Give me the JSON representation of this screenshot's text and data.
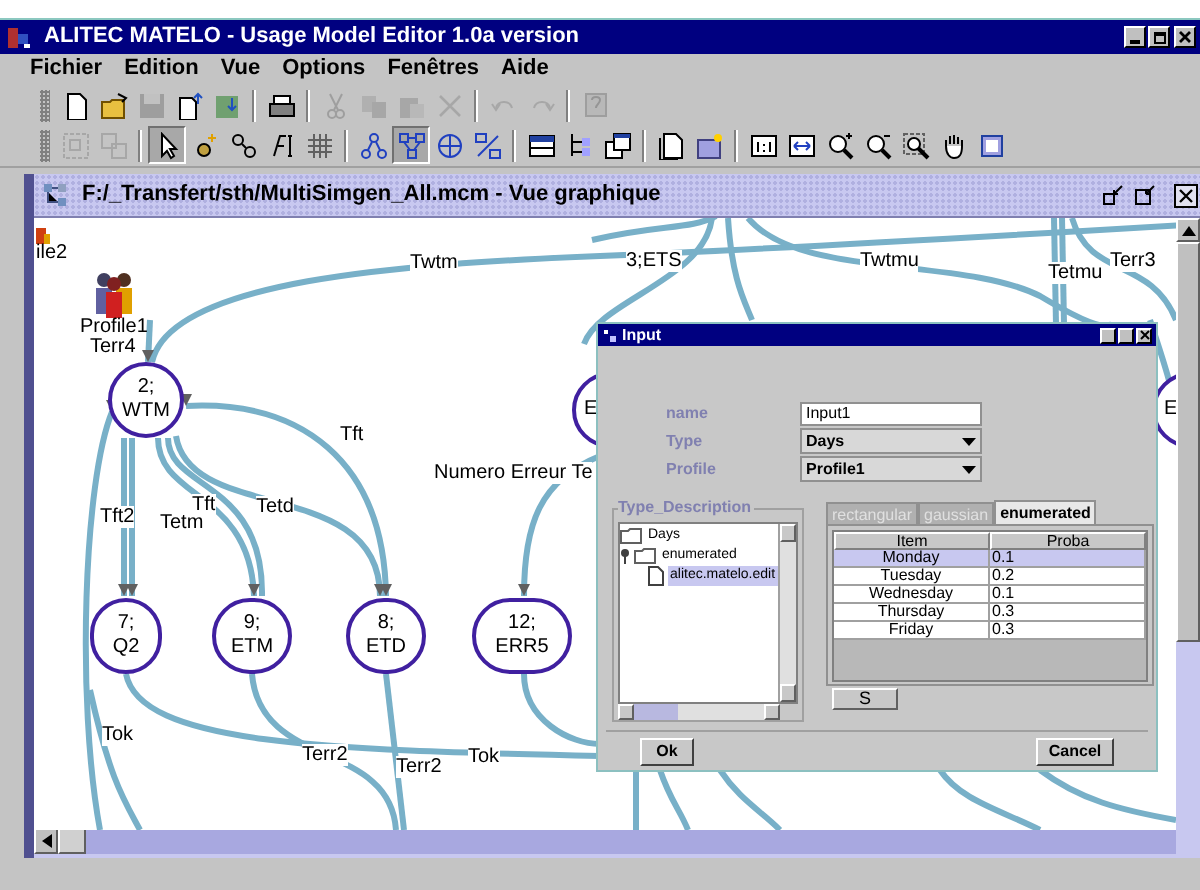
{
  "window": {
    "title": "ALITEC MATELO - Usage Model Editor 1.0a version"
  },
  "menu": [
    {
      "label": "Fichier"
    },
    {
      "label": "Edition"
    },
    {
      "label": "Vue"
    },
    {
      "label": "Options"
    },
    {
      "label": "Fenêtres"
    },
    {
      "label": "Aide"
    }
  ],
  "toolbar_1": [
    [
      {
        "kind": "new",
        "disabled": false
      },
      {
        "kind": "open",
        "disabled": false
      },
      {
        "kind": "save",
        "disabled": true
      },
      {
        "kind": "export",
        "disabled": false
      },
      {
        "kind": "import",
        "disabled": false
      }
    ],
    [
      {
        "kind": "print",
        "disabled": false
      }
    ],
    [
      {
        "kind": "cut",
        "disabled": true
      },
      {
        "kind": "copy",
        "disabled": true
      },
      {
        "kind": "paste",
        "disabled": true
      },
      {
        "kind": "delete",
        "disabled": true
      }
    ],
    [
      {
        "kind": "undo",
        "disabled": true
      },
      {
        "kind": "redo",
        "disabled": true
      }
    ],
    [
      {
        "kind": "help",
        "disabled": true
      }
    ]
  ],
  "toolbar_2": [
    [
      {
        "kind": "group",
        "selected": false,
        "disabled": true
      },
      {
        "kind": "ungroup",
        "selected": false,
        "disabled": true
      }
    ],
    [
      {
        "kind": "pointer",
        "selected": true,
        "disabled": false
      },
      {
        "kind": "node",
        "selected": false,
        "disabled": false
      },
      {
        "kind": "link",
        "selected": false,
        "disabled": false
      },
      {
        "kind": "text",
        "selected": false,
        "disabled": false
      },
      {
        "kind": "grid",
        "selected": false,
        "disabled": false
      }
    ],
    [
      {
        "kind": "tree",
        "selected": false,
        "disabled": false
      },
      {
        "kind": "graph",
        "selected": true,
        "disabled": false
      },
      {
        "kind": "cube",
        "selected": false,
        "disabled": false
      },
      {
        "kind": "swap",
        "selected": false,
        "disabled": false
      }
    ],
    [
      {
        "kind": "table",
        "selected": false,
        "disabled": false
      },
      {
        "kind": "hierarchy",
        "selected": false,
        "disabled": false
      },
      {
        "kind": "windows",
        "selected": false,
        "disabled": false
      }
    ],
    [
      {
        "kind": "page",
        "selected": false,
        "disabled": false
      },
      {
        "kind": "photo",
        "selected": false,
        "disabled": false
      }
    ],
    [
      {
        "kind": "zoom_one",
        "selected": false,
        "disabled": false
      },
      {
        "kind": "fit",
        "selected": false,
        "disabled": false
      },
      {
        "kind": "zoom_in",
        "selected": false,
        "disabled": false
      },
      {
        "kind": "zoom_out",
        "selected": false,
        "disabled": false
      },
      {
        "kind": "zoom_select",
        "selected": false,
        "disabled": false
      },
      {
        "kind": "hand",
        "selected": false,
        "disabled": false
      },
      {
        "kind": "frame",
        "selected": false,
        "disabled": false
      }
    ]
  ],
  "document": {
    "title": "F:/_Transfert/sth/MultiSimgen_All.mcm - Vue graphique",
    "profiles": [
      {
        "label": "ile2"
      },
      {
        "label": "Profile1"
      }
    ],
    "nodes": [
      {
        "number": "2;",
        "name": "WTM"
      },
      {
        "number": "7;",
        "name": "Q2"
      },
      {
        "number": "9;",
        "name": "ETM"
      },
      {
        "number": "8;",
        "name": "ETD"
      },
      {
        "number": "12;",
        "name": "ERR5"
      },
      {
        "name": "E"
      },
      {
        "name": "E"
      }
    ],
    "edge_labels": [
      "Twtm",
      "3;ETS",
      "Twtmu",
      "Tetmu",
      "Terr3",
      "Terr4",
      "Tft",
      "Numero Erreur Te",
      "Tetd",
      "Tft2",
      "Tetm",
      "Tft",
      "Tok",
      "Terr2",
      "Terr2",
      "Tok"
    ]
  },
  "dialog": {
    "title": "Input",
    "fields": [
      {
        "label": "name",
        "kind": "text",
        "value": "Input1"
      },
      {
        "label": "Type",
        "kind": "dropdown",
        "value": "Days"
      },
      {
        "label": "Profile",
        "kind": "dropdown",
        "value": "Profile1"
      }
    ],
    "type_description": {
      "title": "Type_Description",
      "tree": [
        {
          "label": "Days",
          "expanded": false,
          "selected": false
        },
        {
          "label": "enumerated",
          "expanded": true,
          "selected": false,
          "children": [
            {
              "label": "alitec.matelo.edit",
              "expanded": false,
              "selected": true
            }
          ]
        }
      ]
    },
    "tabs": [
      {
        "label": "rectangular",
        "selected": false,
        "disabled": true
      },
      {
        "label": "gaussian",
        "selected": false,
        "disabled": true
      },
      {
        "label": "enumerated",
        "selected": true,
        "disabled": false
      }
    ],
    "table": {
      "columns": [
        "Item",
        "Proba"
      ],
      "rows": [
        {
          "cells": [
            "Monday",
            "0.1"
          ],
          "selected": true
        },
        {
          "cells": [
            "Tuesday",
            "0.2"
          ],
          "selected": false
        },
        {
          "cells": [
            "Wednesday",
            "0.1"
          ],
          "selected": false
        },
        {
          "cells": [
            "Thursday",
            "0.3"
          ],
          "selected": false
        },
        {
          "cells": [
            "Friday",
            "0.3"
          ],
          "selected": false
        }
      ]
    },
    "table_button": "S",
    "buttons": [
      {
        "label": "Ok"
      },
      {
        "label": "Cancel"
      }
    ]
  }
}
